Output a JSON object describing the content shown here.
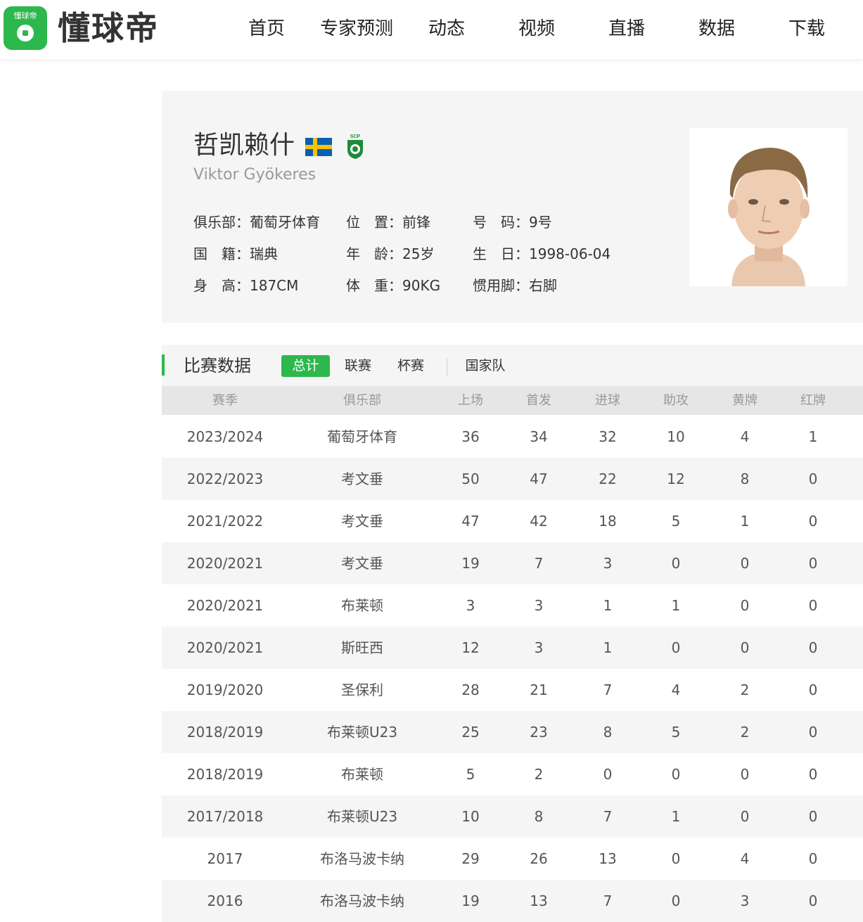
{
  "header": {
    "logo_label": "懂球帝",
    "logo_text": "懂球帝",
    "nav": [
      "首页",
      "专家预测",
      "动态",
      "视频",
      "直播",
      "数据",
      "下载"
    ]
  },
  "player": {
    "name_cn": "哲凯赖什",
    "name_en": "Viktor Gyökeres",
    "flag": "sweden-flag",
    "club_badge": "sporting-cp-badge",
    "info": {
      "club_label": "俱乐部：",
      "club": "葡萄牙体育",
      "position_label": "位　置：",
      "position": "前锋",
      "number_label": "号　码：",
      "number": "9号",
      "nationality_label": "国　籍：",
      "nationality": "瑞典",
      "age_label": "年　龄：",
      "age": "25岁",
      "birthday_label": "生　日：",
      "birthday": "1998-06-04",
      "height_label": "身　高：",
      "height": "187CM",
      "weight_label": "体　重：",
      "weight": "90KG",
      "foot_label": "惯用脚：",
      "foot": "右脚"
    }
  },
  "stats": {
    "title": "比赛数据",
    "tabs": [
      "总计",
      "联赛",
      "杯赛",
      "国家队"
    ],
    "active_tab": 0,
    "columns": [
      "赛季",
      "俱乐部",
      "上场",
      "首发",
      "进球",
      "助攻",
      "黄牌",
      "红牌"
    ],
    "rows": [
      [
        "2023/2024",
        "葡萄牙体育",
        "36",
        "34",
        "32",
        "10",
        "4",
        "1"
      ],
      [
        "2022/2023",
        "考文垂",
        "50",
        "47",
        "22",
        "12",
        "8",
        "0"
      ],
      [
        "2021/2022",
        "考文垂",
        "47",
        "42",
        "18",
        "5",
        "1",
        "0"
      ],
      [
        "2020/2021",
        "考文垂",
        "19",
        "7",
        "3",
        "0",
        "0",
        "0"
      ],
      [
        "2020/2021",
        "布莱顿",
        "3",
        "3",
        "1",
        "1",
        "0",
        "0"
      ],
      [
        "2020/2021",
        "斯旺西",
        "12",
        "3",
        "1",
        "0",
        "0",
        "0"
      ],
      [
        "2019/2020",
        "圣保利",
        "28",
        "21",
        "7",
        "4",
        "2",
        "0"
      ],
      [
        "2018/2019",
        "布莱顿U23",
        "25",
        "23",
        "8",
        "5",
        "2",
        "0"
      ],
      [
        "2018/2019",
        "布莱顿",
        "5",
        "2",
        "0",
        "0",
        "0",
        "0"
      ],
      [
        "2017/2018",
        "布莱顿U23",
        "10",
        "8",
        "7",
        "1",
        "0",
        "0"
      ],
      [
        "2017",
        "布洛马波卡纳",
        "29",
        "26",
        "13",
        "0",
        "4",
        "0"
      ],
      [
        "2016",
        "布洛马波卡纳",
        "19",
        "13",
        "7",
        "0",
        "3",
        "0"
      ]
    ]
  },
  "colors": {
    "accent": "#2db84d",
    "panel": "#f5f5f5",
    "table_head": "#e6e6e6"
  }
}
